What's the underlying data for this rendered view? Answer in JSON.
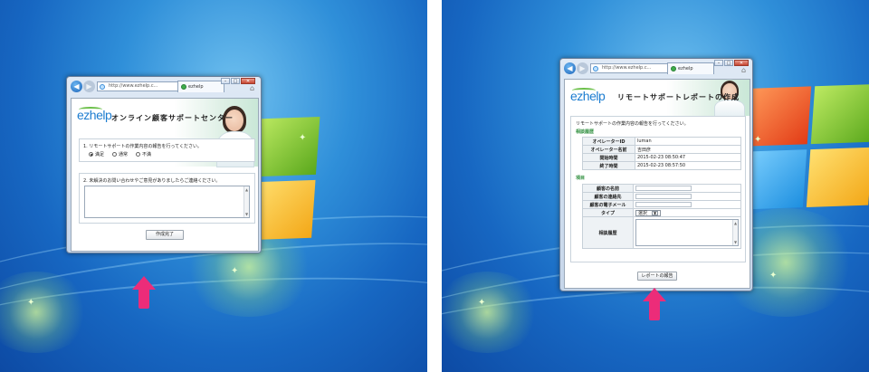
{
  "left": {
    "browser": {
      "address": "http://www.ezhelp.c...",
      "tab_title": "ezhelp",
      "minimize": "–",
      "maximize": "□",
      "close": "✕"
    },
    "brand": "ezhelp",
    "heading": "オンライン顧客サポートセンター",
    "q1": "1. リモートサポートの作業内容の報告を行ってください。",
    "options": [
      "満足",
      "通常",
      "不満"
    ],
    "q2": "2. 未解決のお問い合わせやご意見がありましたらご連絡ください。",
    "submit": "作成完了"
  },
  "right": {
    "browser": {
      "address": "http://www.ezhelp.c...",
      "tab_title": "ezhelp",
      "minimize": "–",
      "maximize": "□",
      "close": "✕"
    },
    "brand": "ezhelp",
    "heading": "リモートサポートレポートの作成",
    "intro": "リモートサポートの作業内容の報告を行ってください。",
    "section_history": "相談履歴",
    "rows": [
      {
        "label": "オペレーターID",
        "value": "luman"
      },
      {
        "label": "オペレーター名前",
        "value": "吉田彦"
      },
      {
        "label": "開始時間",
        "value": "2015-02-23 08:50:47"
      },
      {
        "label": "終了時間",
        "value": "2015-02-23 08:57:50"
      }
    ],
    "section_item": "項目",
    "fields": {
      "name": "顧客の名前",
      "contact": "顧客の連絡先",
      "email": "顧客の電子メール",
      "type": "タイプ",
      "type_value": "選択",
      "history": "相談履歴"
    },
    "submit": "レポートの報告"
  }
}
